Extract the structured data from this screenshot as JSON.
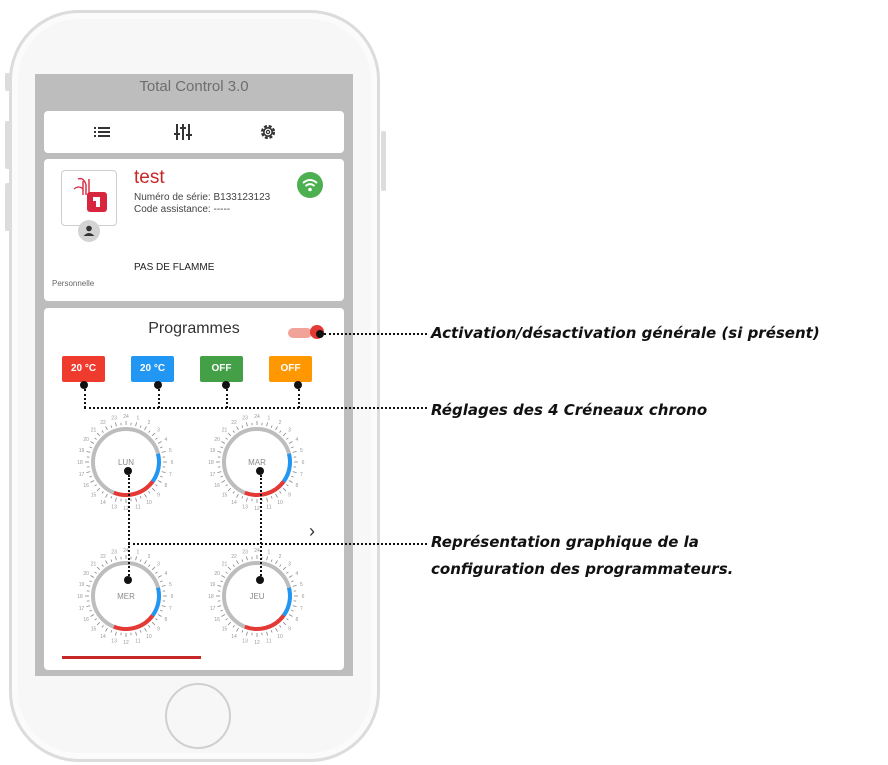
{
  "app": {
    "title": "Total Control 3.0"
  },
  "toolbar": {
    "icons": [
      "list-icon",
      "sliders-icon",
      "gear-icon"
    ]
  },
  "device": {
    "name": "test",
    "serial": "Numéro de série: B133123123",
    "assistance": "Code assistance: -----",
    "status": "PAS DE FLAMME",
    "mode": "Personnelle",
    "wifi_color": "#4caf50"
  },
  "programs": {
    "title": "Programmes",
    "toggle_on": true,
    "slots": [
      {
        "label": "20 °C",
        "color": "#ef3b2d"
      },
      {
        "label": "20 °C",
        "color": "#2196f3"
      },
      {
        "label": "OFF",
        "color": "#43a047"
      },
      {
        "label": "OFF",
        "color": "#ff9800"
      }
    ],
    "days": [
      "LUN",
      "MAR",
      "MER",
      "JEU"
    ]
  },
  "annotations": {
    "activation": "Activation/désactivation générale (si présent)",
    "slots": "Réglages des 4 Créneaux chrono",
    "graph_line1": "Représentation graphique de la",
    "graph_line2": "configuration des programmateurs."
  },
  "colors": {
    "accent": "#c62828",
    "blue_arc": "#2196f3",
    "red_arc": "#e53935"
  }
}
